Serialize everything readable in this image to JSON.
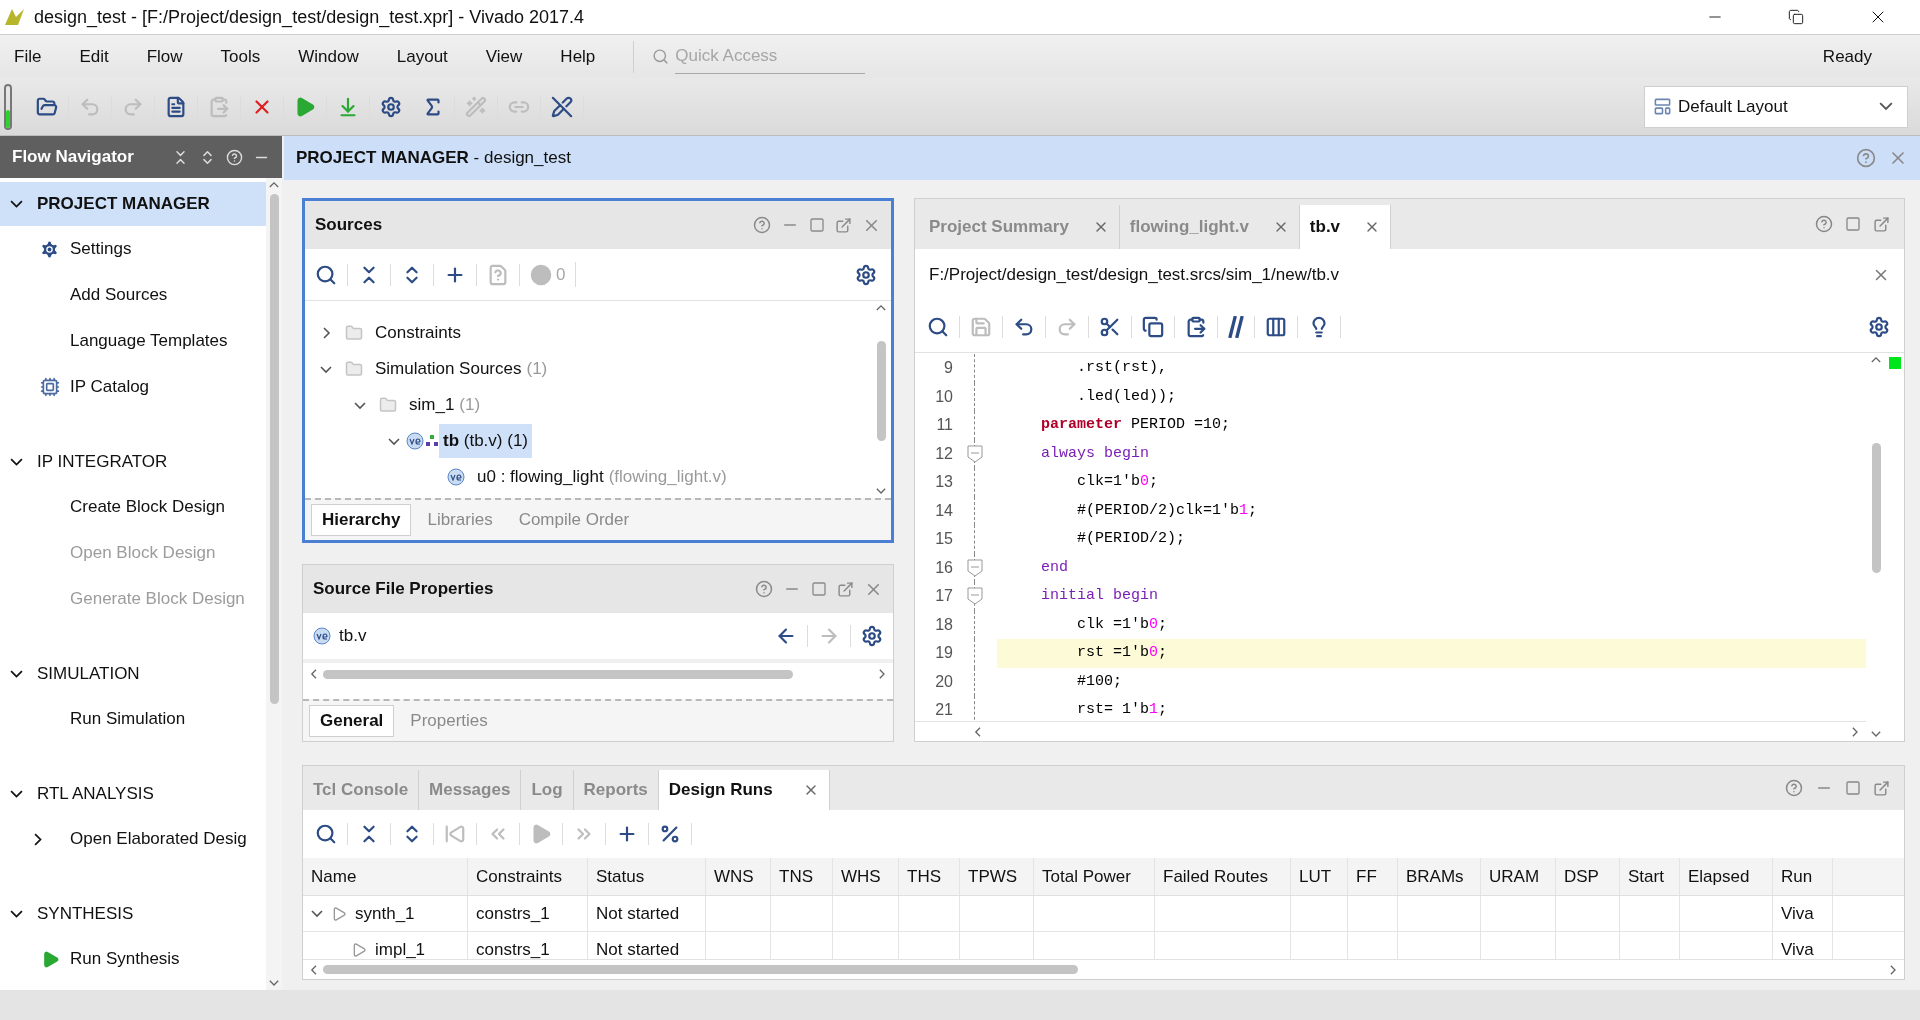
{
  "window": {
    "title": "design_test - [F:/Project/design_test/design_test.xpr] - Vivado 2017.4"
  },
  "menu": [
    "File",
    "Edit",
    "Flow",
    "Tools",
    "Window",
    "Layout",
    "View",
    "Help"
  ],
  "quick_access": {
    "placeholder": "Quick Access"
  },
  "status": "Ready",
  "toolbar": [
    {
      "kind": "open",
      "disabled": false
    },
    {
      "kind": "undo",
      "disabled": true
    },
    {
      "kind": "redo",
      "disabled": true
    },
    {
      "kind": "report",
      "disabled": false
    },
    {
      "kind": "paste",
      "disabled": true
    },
    {
      "kind": "cancel",
      "disabled": false
    },
    {
      "kind": "run",
      "disabled": false
    },
    {
      "kind": "program",
      "disabled": false
    },
    {
      "kind": "settings",
      "disabled": false
    },
    {
      "kind": "sigma",
      "disabled": false
    },
    {
      "kind": "wand",
      "disabled": true
    },
    {
      "kind": "link",
      "disabled": true
    },
    {
      "kind": "tools",
      "disabled": false
    }
  ],
  "layout_select": {
    "value": "Default Layout"
  },
  "flow_navigator": {
    "title": "Flow Navigator",
    "sections": [
      {
        "title": "PROJECT MANAGER",
        "expanded": true,
        "selected": true,
        "items": [
          {
            "label": "Settings",
            "kind": "gear",
            "disabled": false
          },
          {
            "label": "Add Sources",
            "disabled": false
          },
          {
            "label": "Language Templates",
            "disabled": false
          },
          {
            "label": "IP Catalog",
            "kind": "ip",
            "disabled": false
          }
        ]
      },
      {
        "title": "IP INTEGRATOR",
        "expanded": true,
        "selected": false,
        "items": [
          {
            "label": "Create Block Design",
            "disabled": false
          },
          {
            "label": "Open Block Design",
            "disabled": true
          },
          {
            "label": "Generate Block Design",
            "disabled": true
          }
        ]
      },
      {
        "title": "SIMULATION",
        "expanded": true,
        "selected": false,
        "items": [
          {
            "label": "Run Simulation",
            "disabled": false
          }
        ]
      },
      {
        "title": "RTL ANALYSIS",
        "expanded": true,
        "selected": false,
        "items": [
          {
            "label": "Open Elaborated Desig",
            "disabled": false,
            "expanded": false
          }
        ]
      },
      {
        "title": "SYNTHESIS",
        "expanded": true,
        "selected": false,
        "items": [
          {
            "label": "Run Synthesis",
            "kind": "run",
            "disabled": false
          }
        ]
      }
    ]
  },
  "project_manager": {
    "title": "**PROJECT MANAGER** - design_test"
  },
  "sources": {
    "title": "Sources",
    "toolbar": [
      {
        "kind": "search",
        "disabled": false
      },
      {
        "kind": "collapse",
        "disabled": false
      },
      {
        "kind": "expand",
        "disabled": false
      },
      {
        "kind": "add",
        "disabled": false
      },
      {
        "kind": "unknown",
        "disabled": true
      },
      {
        "kind": "status",
        "disabled": true
      },
      {
        "kind": "settings",
        "disabled": false
      }
    ],
    "count": "0",
    "tree": [
      {
        "label": "Constraints",
        "kind": "folder",
        "expanded": false,
        "selected": false
      },
      {
        "label": "Simulation Sources",
        "note": "(1)",
        "kind": "folder",
        "expanded": true,
        "selected": false,
        "children": [
          {
            "label": "sim_1",
            "note": "(1)",
            "kind": "folder",
            "expanded": true,
            "selected": false,
            "children": [
              {
                "label": "**tb** (tb.v) (1)",
                "kind": "verilog-top",
                "expanded": true,
                "selected": true,
                "children": [
                  {
                    "label": "u0 : flowing_light",
                    "note": "(flowing_light.v)",
                    "kind": "verilog",
                    "selected": false
                  }
                ]
              }
            ]
          }
        ]
      }
    ],
    "tabs": [
      {
        "label": "Hierarchy",
        "selected": true
      },
      {
        "label": "Libraries",
        "selected": false
      },
      {
        "label": "Compile Order",
        "selected": false
      }
    ]
  },
  "properties": {
    "title": "Source File Properties",
    "file": "tb.v",
    "toolbar": [
      {
        "kind": "back",
        "disabled": false
      },
      {
        "kind": "forward",
        "disabled": true
      },
      {
        "kind": "settings",
        "disabled": false
      }
    ],
    "tabs": [
      {
        "label": "General",
        "selected": true
      },
      {
        "label": "Properties",
        "selected": false
      }
    ]
  },
  "editor": {
    "tabs": [
      {
        "label": "Project Summary",
        "selected": false
      },
      {
        "label": "flowing_light.v",
        "selected": false
      },
      {
        "label": "tb.v",
        "selected": true
      }
    ],
    "path": "F:/Project/design_test/design_test.srcs/sim_1/new/tb.v",
    "toolbar": [
      {
        "kind": "search",
        "disabled": false
      },
      {
        "kind": "save",
        "disabled": true
      },
      {
        "kind": "undo",
        "disabled": false
      },
      {
        "kind": "redo",
        "disabled": true
      },
      {
        "kind": "cut",
        "disabled": false
      },
      {
        "kind": "copy",
        "disabled": false
      },
      {
        "kind": "paste",
        "disabled": false
      },
      {
        "kind": "comment",
        "disabled": false
      },
      {
        "kind": "columns",
        "disabled": false
      },
      {
        "kind": "hint",
        "disabled": false
      },
      {
        "kind": "settings",
        "disabled": false
      }
    ],
    "lines": [
      {
        "number": "9",
        "fold": false,
        "highlighted": false,
        "segments": [
          {
            "kind": "plain",
            "text": "        .rst(rst),"
          }
        ]
      },
      {
        "number": "10",
        "fold": false,
        "highlighted": false,
        "segments": [
          {
            "kind": "plain",
            "text": "        .led(led));"
          }
        ]
      },
      {
        "number": "11",
        "fold": false,
        "highlighted": false,
        "segments": [
          {
            "kind": "reserved",
            "text": "    parameter"
          },
          {
            "kind": "plain",
            "text": " PERIOD =10;"
          }
        ]
      },
      {
        "number": "12",
        "fold": true,
        "highlighted": false,
        "segments": [
          {
            "kind": "keyword",
            "text": "    always begin"
          }
        ]
      },
      {
        "number": "13",
        "fold": false,
        "highlighted": false,
        "segments": [
          {
            "kind": "plain",
            "text": "        clk=1'b"
          },
          {
            "kind": "number",
            "text": "0"
          },
          {
            "kind": "plain",
            "text": ";"
          }
        ]
      },
      {
        "number": "14",
        "fold": false,
        "highlighted": false,
        "segments": [
          {
            "kind": "plain",
            "text": "        #(PERIOD/2)clk=1'b"
          },
          {
            "kind": "number",
            "text": "1"
          },
          {
            "kind": "plain",
            "text": ";"
          }
        ]
      },
      {
        "number": "15",
        "fold": false,
        "highlighted": false,
        "segments": [
          {
            "kind": "plain",
            "text": "        #(PERIOD/2);"
          }
        ]
      },
      {
        "number": "16",
        "fold": true,
        "highlighted": false,
        "segments": [
          {
            "kind": "keyword",
            "text": "    end"
          }
        ]
      },
      {
        "number": "17",
        "fold": true,
        "highlighted": false,
        "segments": [
          {
            "kind": "keyword",
            "text": "    initial begin"
          }
        ]
      },
      {
        "number": "18",
        "fold": false,
        "highlighted": false,
        "segments": [
          {
            "kind": "plain",
            "text": "        clk =1'b"
          },
          {
            "kind": "number",
            "text": "0"
          },
          {
            "kind": "plain",
            "text": ";"
          }
        ]
      },
      {
        "number": "19",
        "fold": false,
        "highlighted": true,
        "segments": [
          {
            "kind": "plain",
            "text": "        rst =1'b"
          },
          {
            "kind": "number",
            "text": "0"
          },
          {
            "kind": "plain",
            "text": ";"
          }
        ]
      },
      {
        "number": "20",
        "fold": false,
        "highlighted": false,
        "segments": [
          {
            "kind": "plain",
            "text": "        #100;"
          }
        ]
      },
      {
        "number": "21",
        "fold": false,
        "highlighted": false,
        "segments": [
          {
            "kind": "plain",
            "text": "        rst= 1'b"
          },
          {
            "kind": "number",
            "text": "1"
          },
          {
            "kind": "plain",
            "text": ";"
          }
        ]
      }
    ]
  },
  "runs_panel": {
    "tabs": [
      {
        "label": "Tcl Console",
        "selected": false,
        "closable": false
      },
      {
        "label": "Messages",
        "selected": false,
        "closable": false
      },
      {
        "label": "Log",
        "selected": false,
        "closable": false
      },
      {
        "label": "Reports",
        "selected": false,
        "closable": false
      },
      {
        "label": "Design Runs",
        "selected": true,
        "closable": true
      }
    ],
    "toolbar": [
      {
        "kind": "search",
        "disabled": false
      },
      {
        "kind": "collapse",
        "disabled": false
      },
      {
        "kind": "expand",
        "disabled": false
      },
      {
        "kind": "first",
        "disabled": true
      },
      {
        "kind": "previous",
        "disabled": true
      },
      {
        "kind": "play",
        "disabled": true
      },
      {
        "kind": "next",
        "disabled": true
      },
      {
        "kind": "add",
        "disabled": false
      },
      {
        "kind": "percent",
        "disabled": false
      }
    ],
    "columns": [
      "Name",
      "Constraints",
      "Status",
      "WNS",
      "TNS",
      "WHS",
      "THS",
      "TPWS",
      "Total Power",
      "Failed Routes",
      "LUT",
      "FF",
      "BRAMs",
      "URAM",
      "DSP",
      "Start",
      "Elapsed",
      "Run"
    ],
    "rows": [
      {
        "name": "synth_1",
        "constraints": "constrs_1",
        "status": "Not started",
        "run": "Viva",
        "expanded": true,
        "children": [
          {
            "name": "impl_1",
            "constraints": "constrs_1",
            "status": "Not started",
            "run": "Viva"
          }
        ]
      }
    ]
  }
}
